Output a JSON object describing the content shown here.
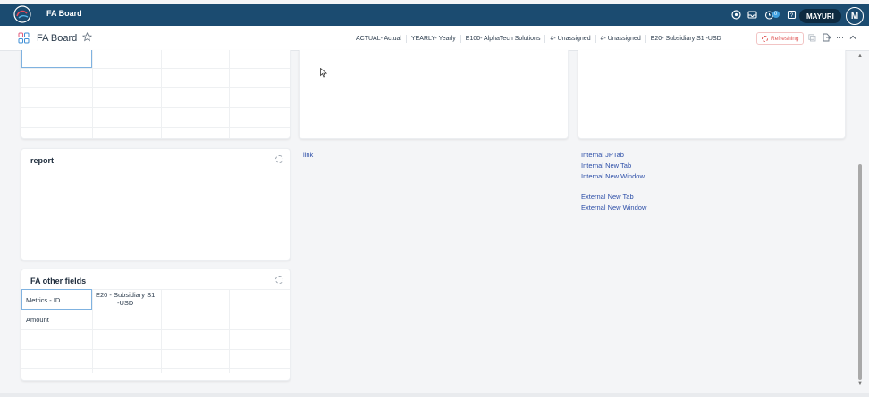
{
  "app": {
    "title": "FA Board",
    "user": "MAYURI",
    "avatar_initial": "M",
    "notification_count": "0",
    "colors": {
      "bar": "#1b4b70",
      "link": "#2d4fa8",
      "refresh": "#e05656"
    }
  },
  "board": {
    "title": "FA Board",
    "filters": [
      "ACTUAL- Actual",
      "YEARLY- Yearly",
      "E100- AlphaTech Solutions",
      "#- Unassigned",
      "#- Unassigned",
      "E20- Subsidiary S1 -USD"
    ],
    "refresh_label": "Refreshing"
  },
  "widgets": {
    "report": {
      "title": "report"
    },
    "fa_other_fields": {
      "title": "FA other fields",
      "header_col1": "Metrics - ID",
      "header_col2_line1": "E20 - Subsidiary S1",
      "header_col2_line2": "-USD",
      "row1": "Amount"
    },
    "link_widget": {
      "label": "link"
    },
    "links": {
      "internal_jptab": "Internal JPTab",
      "internal_new_tab": "Internal New Tab",
      "internal_new_window": "Internal New Window",
      "external_new_tab": "External New Tab",
      "external_new_window": "External New Window"
    }
  }
}
